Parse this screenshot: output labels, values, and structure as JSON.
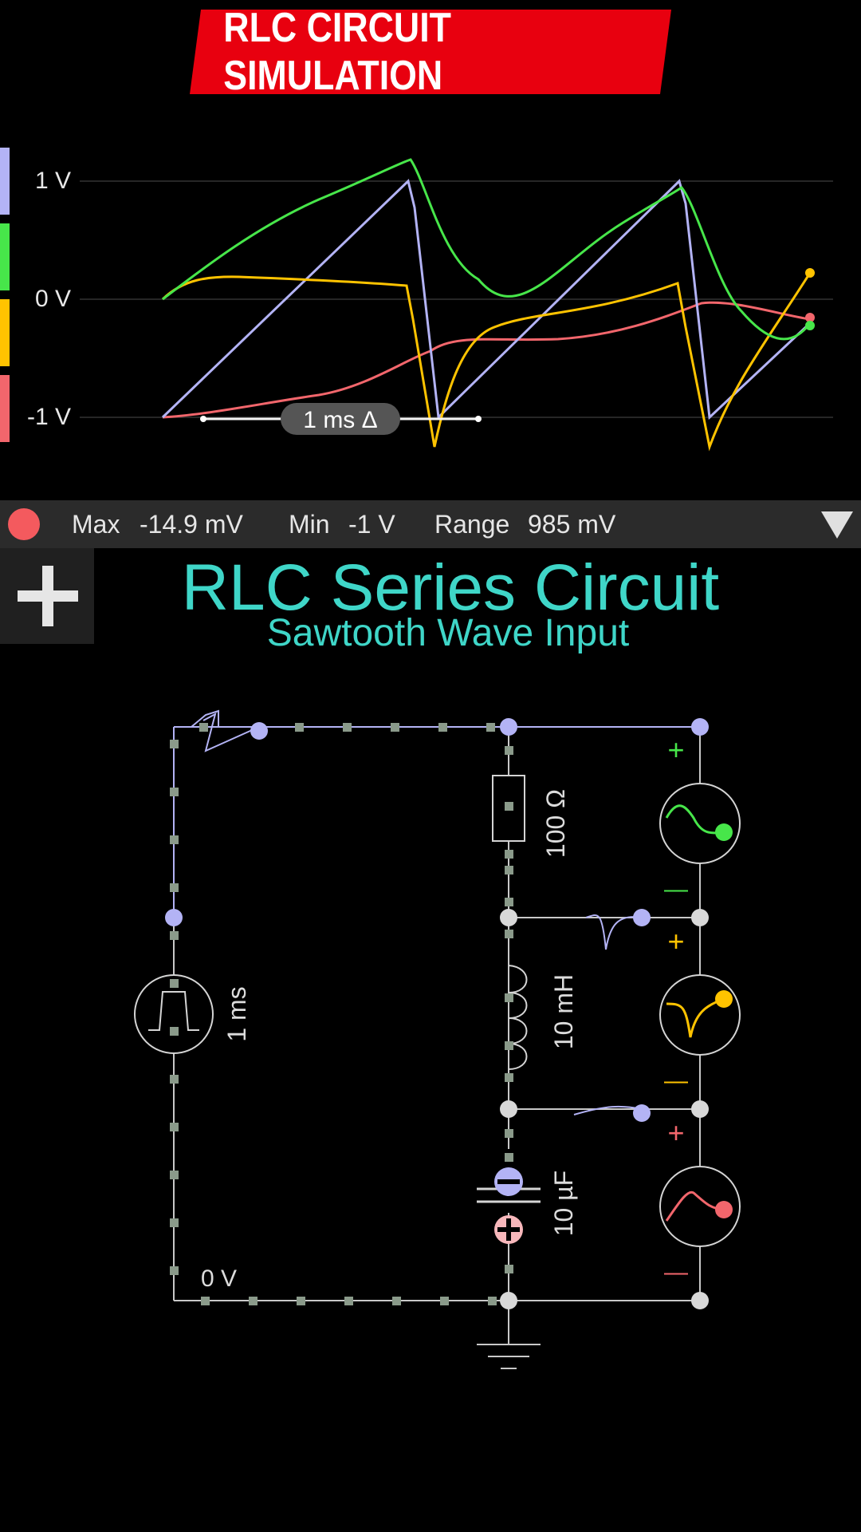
{
  "banner": {
    "title": "RLC CIRCUIT SIMULATION",
    "color": "#e8000f"
  },
  "scope": {
    "y_labels": [
      "1 V",
      "0 V",
      "-1 V"
    ],
    "time_marker": "1 ms Δ",
    "channel_colors": [
      "#b3b3f5",
      "#47e64a",
      "#ffc300",
      "#f2666c"
    ]
  },
  "status": {
    "max_label": "Max",
    "max_value": "-14.9 mV",
    "min_label": "Min",
    "min_value": "-1 V",
    "range_label": "Range",
    "range_value": "985 mV"
  },
  "circuit": {
    "title": "RLC Series Circuit",
    "subtitle": "Sawtooth Wave Input",
    "source_label": "1 ms",
    "resistor_label": "100 Ω",
    "inductor_label": "10 mH",
    "capacitor_label": "10 µF",
    "ground_label": "0 V",
    "plus_sign": "+",
    "minus_sign": "—"
  }
}
